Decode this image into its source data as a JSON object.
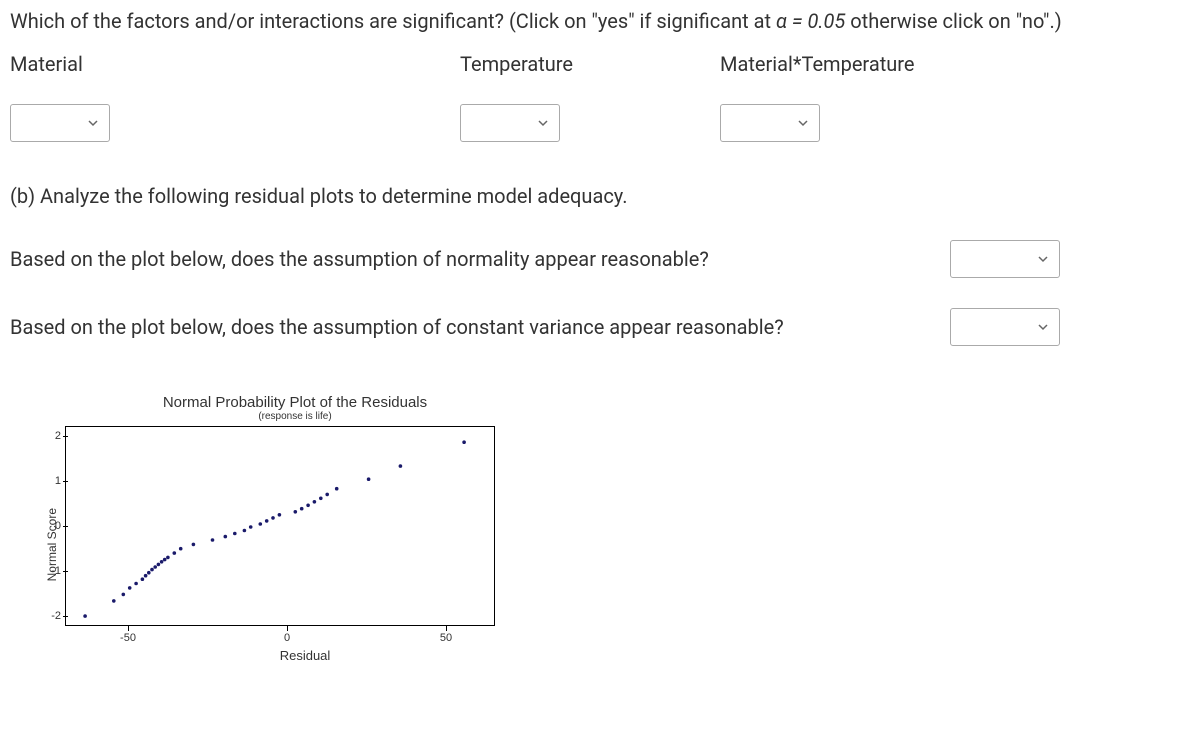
{
  "question": {
    "prefix": "Which of the factors and/or interactions are significant? (Click on \"yes\" if significant at ",
    "alpha_expr": "α = 0.05",
    "suffix": " otherwise click on \"no\".)"
  },
  "factors": {
    "material": "Material",
    "temperature": "Temperature",
    "interaction": "Material*Temperature"
  },
  "section_b": "(b) Analyze the following residual plots to determine model adequacy.",
  "q_normality": "Based on the plot below, does the assumption of normality appear reasonable?",
  "q_variance": "Based on the plot below, does the assumption of constant variance appear reasonable?",
  "chart": {
    "title": "Normal Probability Plot of the Residuals",
    "subtitle": "(response is life)",
    "ylabel": "Normal Score",
    "xlabel": "Residual",
    "yticks": [
      "2",
      "1",
      "0",
      "-1",
      "-2"
    ],
    "xticks": [
      "-50",
      "0",
      "50"
    ]
  },
  "chart_data": {
    "type": "scatter",
    "xlabel": "Residual",
    "ylabel": "Normal Score",
    "title": "Normal Probability Plot of the Residuals",
    "xlim": [
      -70,
      65
    ],
    "ylim": [
      -2.3,
      2.3
    ],
    "series": [
      {
        "name": "residuals",
        "x": [
          -64,
          -55,
          -52,
          -50,
          -48,
          -46,
          -45,
          -44,
          -43,
          -42,
          -41,
          -40,
          -39,
          -38,
          -36,
          -34,
          -30,
          -24,
          -20,
          -17,
          -14,
          -12,
          -9,
          -7,
          -5,
          -3,
          2,
          4,
          6,
          8,
          10,
          12,
          15,
          25,
          35,
          55
        ],
        "y": [
          -2.05,
          -1.7,
          -1.55,
          -1.4,
          -1.3,
          -1.2,
          -1.12,
          -1.05,
          -0.98,
          -0.92,
          -0.86,
          -0.8,
          -0.75,
          -0.7,
          -0.6,
          -0.5,
          -0.4,
          -0.3,
          -0.22,
          -0.15,
          -0.08,
          0.0,
          0.07,
          0.14,
          0.21,
          0.28,
          0.35,
          0.42,
          0.5,
          0.58,
          0.66,
          0.75,
          0.88,
          1.1,
          1.4,
          1.95
        ]
      }
    ]
  }
}
